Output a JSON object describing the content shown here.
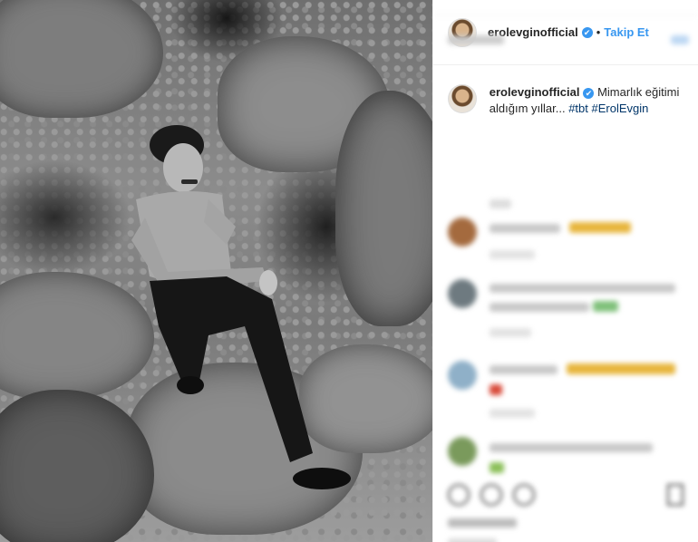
{
  "post": {
    "username": "erolevginofficial",
    "verified_mark": "✔",
    "separator": "•",
    "follow_label": "Takip Et",
    "caption_text": "Mimarlık eğitimi aldığım yıllar...",
    "hashtags": [
      "#tbt",
      "#ErolEvgin"
    ],
    "photo_description_icon": "photo"
  },
  "colors": {
    "link_blue": "#3897f0",
    "hashtag_blue": "#003569",
    "border": "#efefef"
  }
}
